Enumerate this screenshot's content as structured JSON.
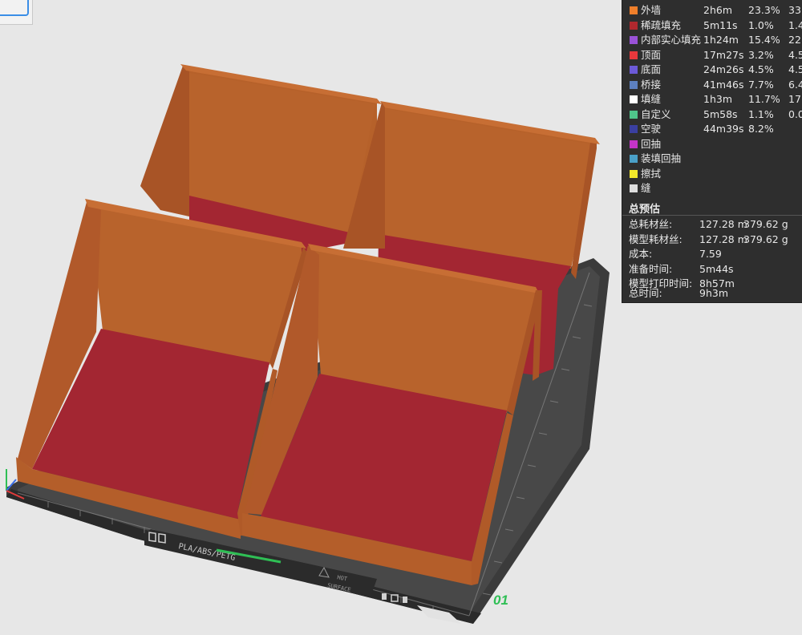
{
  "plate": {
    "label": "PLA/ABS/PETG",
    "hot_label": "HOT",
    "surface_label": "SURFACE",
    "number": "01"
  },
  "colors": {
    "background": "#e7e7e7",
    "wall": "#b8622a",
    "floor": "#a32632",
    "plate": "#3a3a3a",
    "panel": "#2e2e2e"
  },
  "icons": {
    "axis": "xyz-axis-icon",
    "plate_logo": "plate-logo-icon"
  },
  "stats": {
    "feature_rows": [
      {
        "color": "#f07f2a",
        "label": "外墙",
        "time": "2h6m",
        "percent": "23.3%",
        "extra": "33."
      },
      {
        "color": "#b0282e",
        "label": "稀疏填充",
        "time": "5m11s",
        "percent": "1.0%",
        "extra": "1.4"
      },
      {
        "color": "#9a52d8",
        "label": "内部实心填充",
        "time": "1h24m",
        "percent": "15.4%",
        "extra": "22."
      },
      {
        "color": "#e8383c",
        "label": "顶面",
        "time": "17m27s",
        "percent": "3.2%",
        "extra": "4.5"
      },
      {
        "color": "#6c5ad8",
        "label": "底面",
        "time": "24m26s",
        "percent": "4.5%",
        "extra": "4.5"
      },
      {
        "color": "#5d80c0",
        "label": "桥接",
        "time": "41m46s",
        "percent": "7.7%",
        "extra": "6.4"
      },
      {
        "color": "#ffffff",
        "label": "填缝",
        "time": "1h3m",
        "percent": "11.7%",
        "extra": "17."
      },
      {
        "color": "#4fc48a",
        "label": "自定义",
        "time": "5m58s",
        "percent": "1.1%",
        "extra": "0.0"
      },
      {
        "color": "#3a3fa0",
        "label": "空驶",
        "time": "44m39s",
        "percent": "8.2%",
        "extra": ""
      },
      {
        "color": "#c334c8",
        "label": "回抽",
        "time": "",
        "percent": "",
        "extra": ""
      },
      {
        "color": "#4aa0c8",
        "label": "装填回抽",
        "time": "",
        "percent": "",
        "extra": ""
      },
      {
        "color": "#f2e82a",
        "label": "擦拭",
        "time": "",
        "percent": "",
        "extra": ""
      },
      {
        "color": "#dddddd",
        "label": "缝",
        "time": "",
        "percent": "",
        "extra": ""
      }
    ],
    "summary_title": "总预估",
    "summary_rows": [
      {
        "label": "总耗材丝:",
        "value1": "127.28 m",
        "value2": "379.62 g"
      },
      {
        "label": "模型耗材丝:",
        "value1": "127.28 m",
        "value2": "379.62 g"
      },
      {
        "label": "成本:",
        "value1": "7.59",
        "value2": ""
      },
      {
        "label": "准备时间:",
        "value1": "5m44s",
        "value2": ""
      },
      {
        "label": "模型打印时间:",
        "value1": "8h57m",
        "value2": ""
      },
      {
        "label": "总时间:",
        "value1": "9h3m",
        "value2": ""
      }
    ]
  }
}
